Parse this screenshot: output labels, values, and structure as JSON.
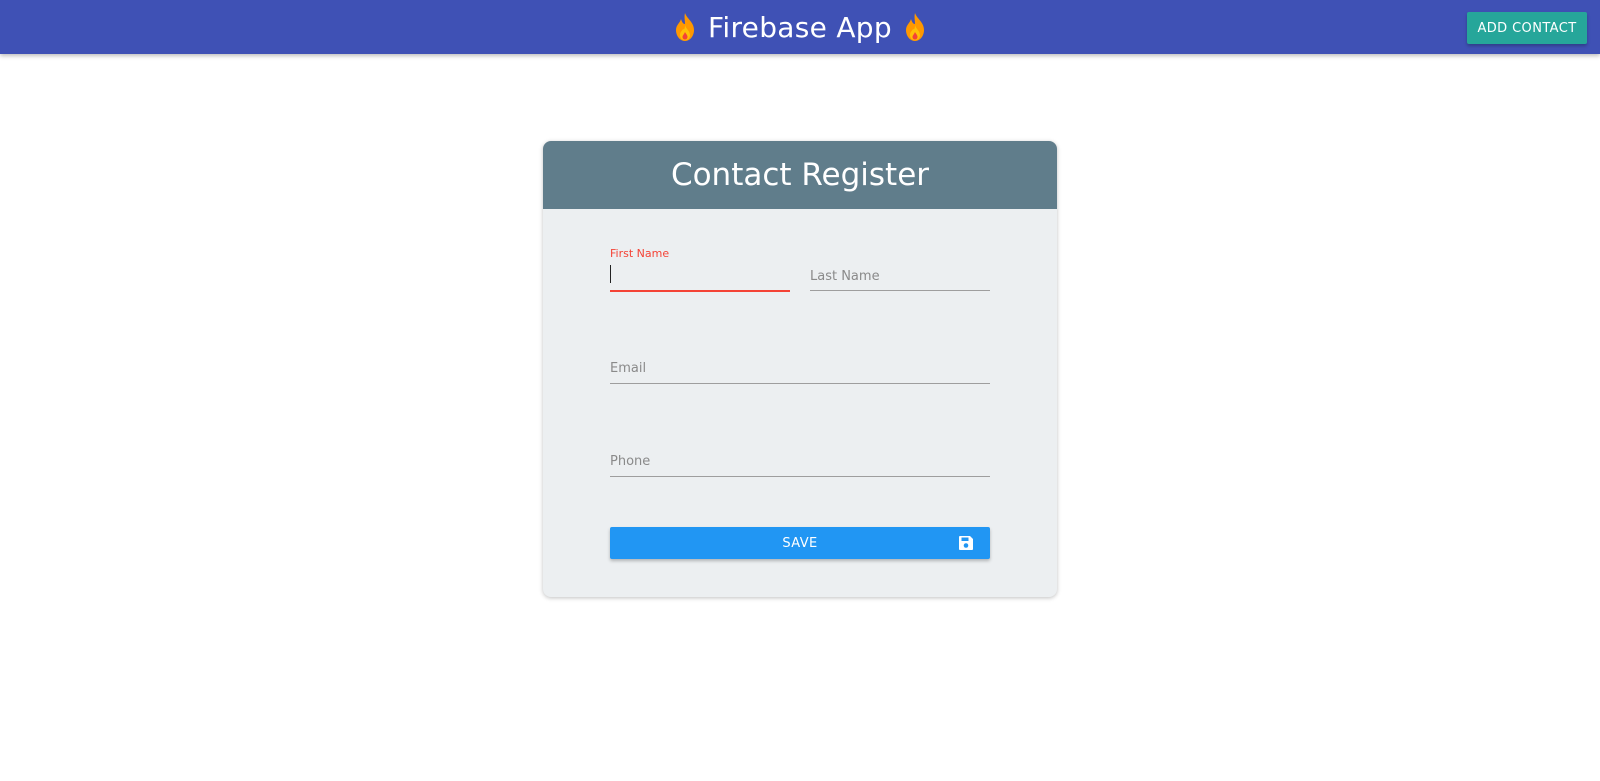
{
  "app": {
    "title": "Firebase App",
    "title_icon": "fire-icon"
  },
  "toolbar": {
    "add_contact_label": "ADD CONTACT"
  },
  "form": {
    "title": "Contact Register",
    "fields": {
      "first_name": {
        "label": "First Name",
        "value": "",
        "focused": true
      },
      "last_name": {
        "label": "Last Name",
        "value": ""
      },
      "email": {
        "label": "Email",
        "value": ""
      },
      "phone": {
        "label": "Phone",
        "value": ""
      }
    },
    "save_label": "SAVE",
    "save_icon": "floppy-disk-icon"
  },
  "colors": {
    "appbar": "#3f51b5",
    "add_button": "#26a69a",
    "card_header": "#607d8b",
    "card_body": "#eceff1",
    "active_field": "#f44336",
    "save_button": "#2196f3"
  }
}
